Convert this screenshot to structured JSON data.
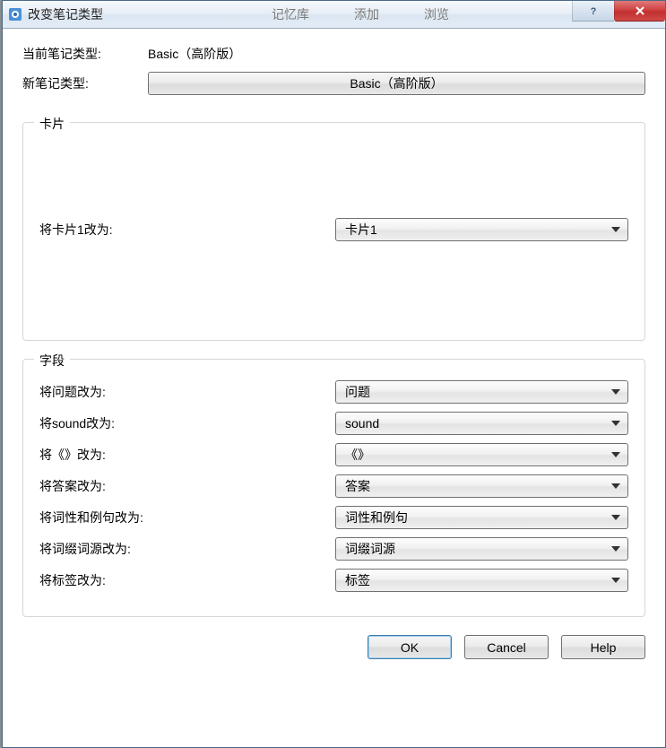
{
  "window": {
    "title": "改变笔记类型",
    "bg_tabs": [
      "记忆库",
      "添加",
      "浏览"
    ]
  },
  "header": {
    "current_type_label": "当前笔记类型:",
    "current_type_value": "Basic（高阶版）",
    "new_type_label": "新笔记类型:",
    "new_type_button": "Basic（高阶版）"
  },
  "card_group": {
    "legend": "卡片",
    "row_label": "将卡片1改为:",
    "row_value": "卡片1"
  },
  "fields_group": {
    "legend": "字段",
    "rows": [
      {
        "label": "将问题改为:",
        "value": "问题"
      },
      {
        "label": "将sound改为:",
        "value": "sound"
      },
      {
        "label": "将《》改为:",
        "value": "《》"
      },
      {
        "label": "将答案改为:",
        "value": "答案"
      },
      {
        "label": "将词性和例句改为:",
        "value": "词性和例句"
      },
      {
        "label": "将词缀词源改为:",
        "value": "词缀词源"
      },
      {
        "label": "将标签改为:",
        "value": "标签"
      }
    ]
  },
  "buttons": {
    "ok": "OK",
    "cancel": "Cancel",
    "help": "Help"
  }
}
